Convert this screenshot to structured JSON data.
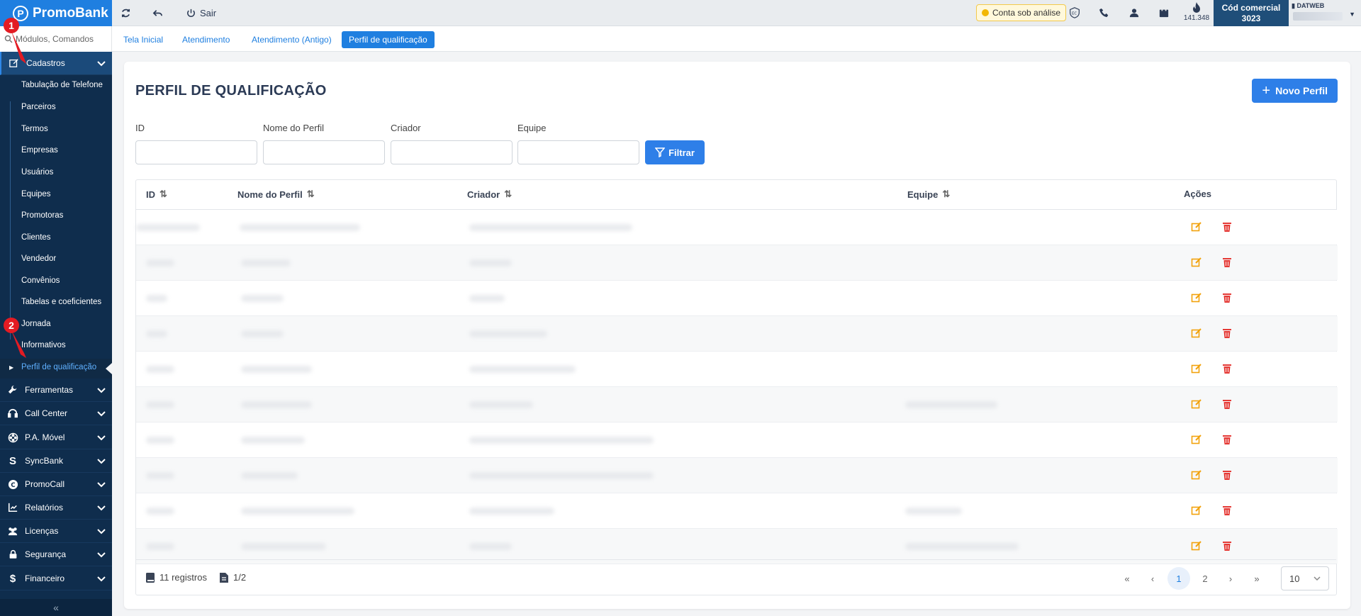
{
  "topbar": {
    "brand": "PromoBank",
    "exit_label": "Sair",
    "status_badge": "Conta sob análise",
    "credits": "141.348",
    "cod_label": "Cód comercial",
    "cod_value": "3023",
    "user_company": "DATWEB"
  },
  "sidebar": {
    "search_placeholder": "Módulos, Comandos",
    "active_group": "Cadastros",
    "sub_items": [
      "Tabulação de Telefone",
      "Parceiros",
      "Termos",
      "Empresas",
      "Usuários",
      "Equipes",
      "Promotoras",
      "Clientes",
      "Vendedor",
      "Convênios",
      "Tabelas e coeficientes",
      "Jornada",
      "Informativos",
      "Perfil de qualificação"
    ],
    "groups": [
      "Ferramentas",
      "Call Center",
      "P.A. Móvel",
      "SyncBank",
      "PromoCall",
      "Relatórios",
      "Licenças",
      "Segurança",
      "Financeiro"
    ],
    "collapse_icon": "«"
  },
  "annotations": {
    "marker1": "1",
    "marker2": "2"
  },
  "tabs": [
    "Tela Inicial",
    "Atendimento",
    "Atendimento (Antigo)",
    "Perfil de qualificação"
  ],
  "page": {
    "title": "PERFIL DE QUALIFICAÇÃO",
    "new_button": "Novo Perfil",
    "filters": {
      "id_label": "ID",
      "name_label": "Nome do Perfil",
      "creator_label": "Criador",
      "team_label": "Equipe",
      "filter_button": "Filtrar"
    },
    "table": {
      "columns": [
        "ID",
        "Nome do Perfil",
        "Criador",
        "Equipe",
        "Ações"
      ],
      "rows_visible": 10
    },
    "footer": {
      "records": "11 registros",
      "pages": "1/2",
      "page_first": "«",
      "page_prev": "‹",
      "page_1": "1",
      "page_2": "2",
      "page_next": "›",
      "page_last": "»",
      "per_page": "10"
    }
  },
  "colors": {
    "brand": "#1f7fe0",
    "sidebar": "#0f2d4d",
    "edit": "#f2a20c",
    "delete": "#e53935",
    "marker": "#e31b23"
  }
}
